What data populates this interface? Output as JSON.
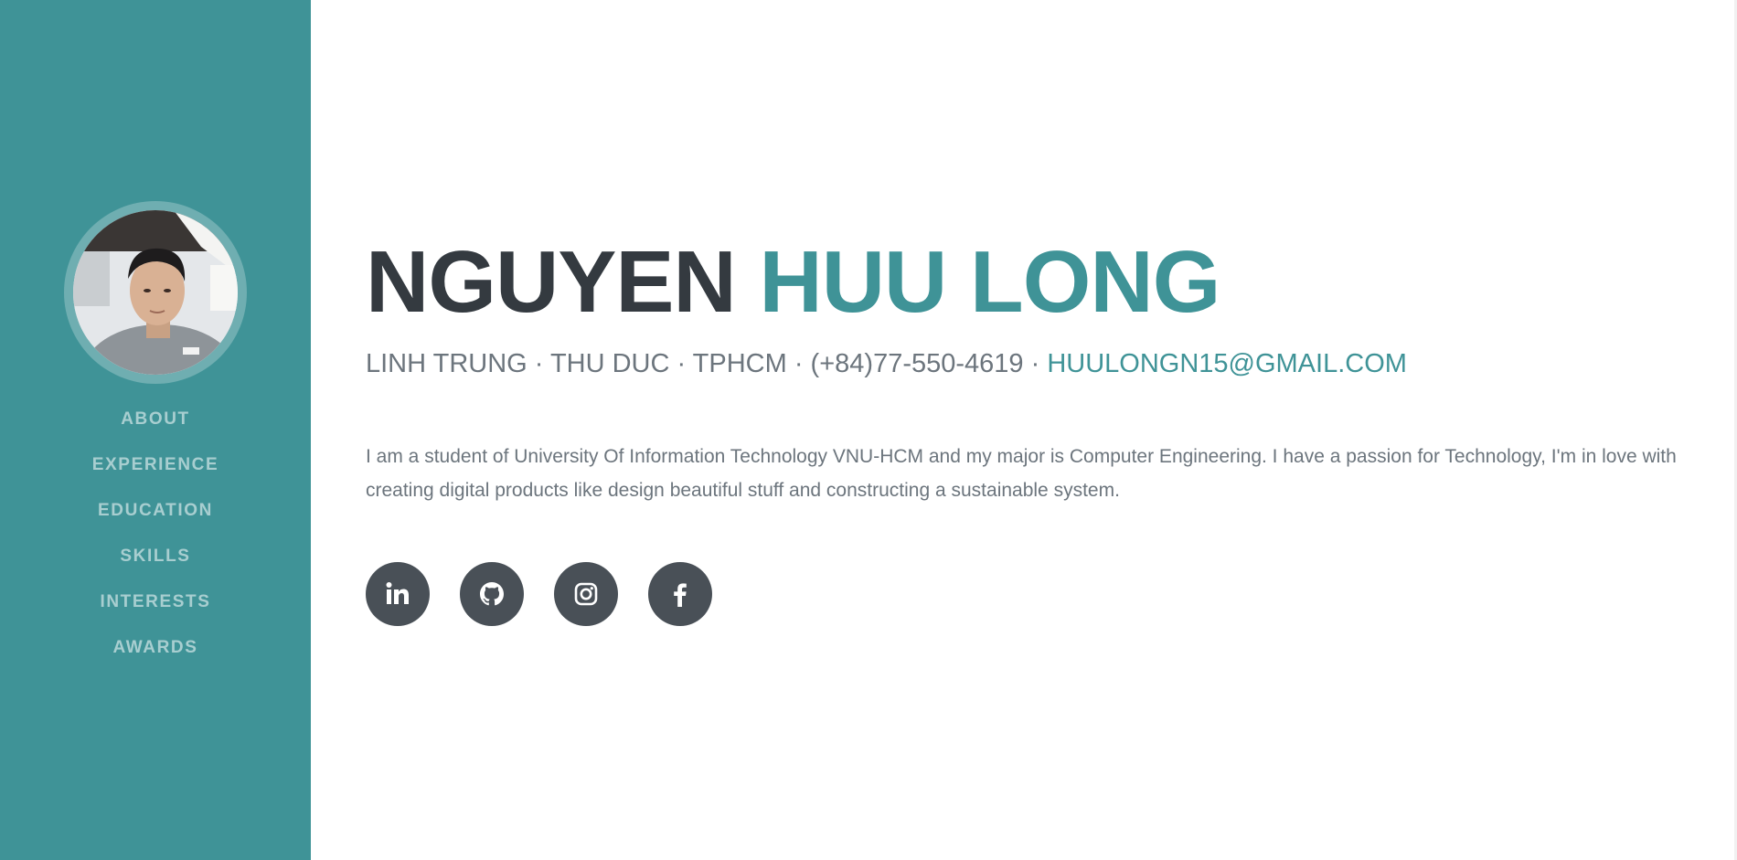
{
  "sidebar": {
    "nav": [
      {
        "label": "ABOUT"
      },
      {
        "label": "EXPERIENCE"
      },
      {
        "label": "EDUCATION"
      },
      {
        "label": "SKILLS"
      },
      {
        "label": "INTERESTS"
      },
      {
        "label": "AWARDS"
      }
    ]
  },
  "hero": {
    "first_name": "NGUYEN",
    "last_name": "HUU LONG",
    "address": "LINH TRUNG · THU DUC · TPHCM · (+84)77-550-4619 · ",
    "email": "HUULONGN15@GMAIL.COM",
    "bio": "I am a student of University Of Information Technology VNU-HCM and my major is Computer Engineering. I have a passion for Technology, I'm in love with creating digital products like design beautiful stuff and constructing a sustainable system."
  },
  "social": [
    {
      "icon": "linkedin-icon"
    },
    {
      "icon": "github-icon"
    },
    {
      "icon": "instagram-icon"
    },
    {
      "icon": "facebook-icon"
    }
  ],
  "colors": {
    "sidebar_bg": "#3f9397",
    "accent": "#3f9397",
    "heading": "#343a40",
    "text": "#6c757d",
    "social_bg": "#495057"
  }
}
